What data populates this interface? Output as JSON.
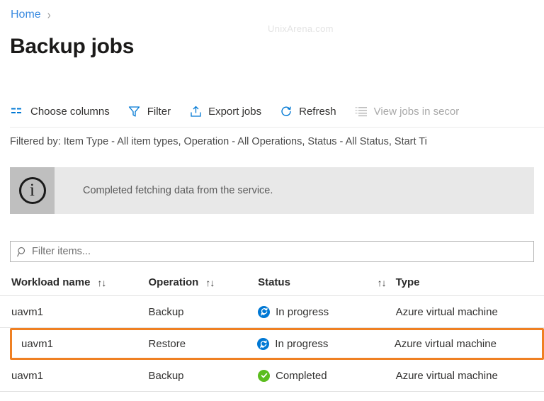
{
  "watermark": "UnixArena.com",
  "breadcrumb": {
    "home_label": "Home",
    "separator": "›"
  },
  "page_title": "Backup jobs",
  "toolbar": {
    "choose_columns_label": "Choose columns",
    "filter_label": "Filter",
    "export_jobs_label": "Export jobs",
    "refresh_label": "Refresh",
    "view_secondary_label": "View jobs in secor",
    "accent_color": "#0078d4",
    "disabled_color": "#a8a8a8"
  },
  "filtered_by": "Filtered by: Item Type - All item types, Operation - All Operations, Status - All Status, Start Ti",
  "info_banner": {
    "icon_glyph": "i",
    "message": "Completed fetching data from the service.",
    "icon_block_color": "#bfbfbf",
    "background_color": "#e8e8e8"
  },
  "search": {
    "placeholder": "Filter items...",
    "value": ""
  },
  "table": {
    "sort_glyph": "↑↓",
    "columns": [
      {
        "label": "Workload name",
        "sortable": true
      },
      {
        "label": "Operation",
        "sortable": true
      },
      {
        "label": "Status",
        "sortable": true
      },
      {
        "label": "Type",
        "sortable": false
      }
    ],
    "rows": [
      {
        "workload": "uavm1",
        "operation": "Backup",
        "status": "In progress",
        "status_icon": "in-progress-icon",
        "status_color": "#0078d4",
        "type": "Azure virtual machine",
        "highlighted": false
      },
      {
        "workload": "uavm1",
        "operation": "Restore",
        "status": "In progress",
        "status_icon": "in-progress-icon",
        "status_color": "#0078d4",
        "type": "Azure virtual machine",
        "highlighted": true
      },
      {
        "workload": "uavm1",
        "operation": "Backup",
        "status": "Completed",
        "status_icon": "completed-icon",
        "status_color": "#5bbd1e",
        "type": "Azure virtual machine",
        "highlighted": false
      }
    ],
    "highlight_color": "#ef8023"
  }
}
